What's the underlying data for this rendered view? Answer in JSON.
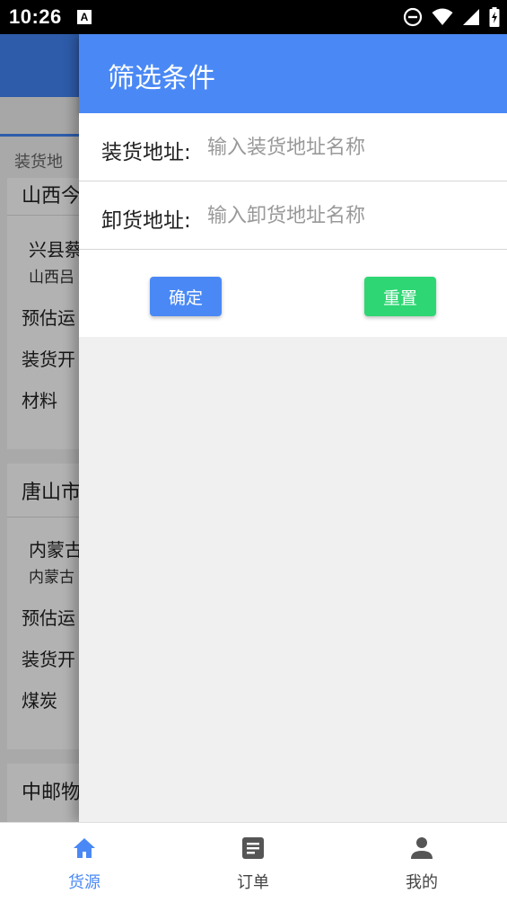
{
  "status_bar": {
    "time": "10:26",
    "notification_icon": "a-icon"
  },
  "background_page": {
    "filter_label": "装货地",
    "cards": [
      {
        "title": "山西今",
        "route_from": "兴县蔡",
        "route_sub": "山西吕",
        "estimate_label": "预估运",
        "load_label": "装货开",
        "material_label": "材料"
      },
      {
        "title": "唐山市",
        "route_from": "内蒙古",
        "route_sub": "内蒙古",
        "estimate_label": "预估运",
        "load_label": "装货开",
        "material_label": "煤炭"
      },
      {
        "title": "中邮物"
      }
    ]
  },
  "drawer": {
    "title": "筛选条件",
    "load_address": {
      "label": "装货地址:",
      "placeholder": "输入装货地址名称",
      "value": ""
    },
    "unload_address": {
      "label": "卸货地址:",
      "placeholder": "输入卸货地址名称",
      "value": ""
    },
    "confirm_label": "确定",
    "reset_label": "重置"
  },
  "bottom_nav": {
    "items": [
      {
        "label": "货源",
        "icon": "home-icon",
        "active": true
      },
      {
        "label": "订单",
        "icon": "document-icon",
        "active": false
      },
      {
        "label": "我的",
        "icon": "person-icon",
        "active": false
      }
    ]
  },
  "colors": {
    "primary": "#4a89f5",
    "reset_button": "#2ed773",
    "nav_active": "#4a89f5",
    "nav_inactive": "#555555"
  }
}
